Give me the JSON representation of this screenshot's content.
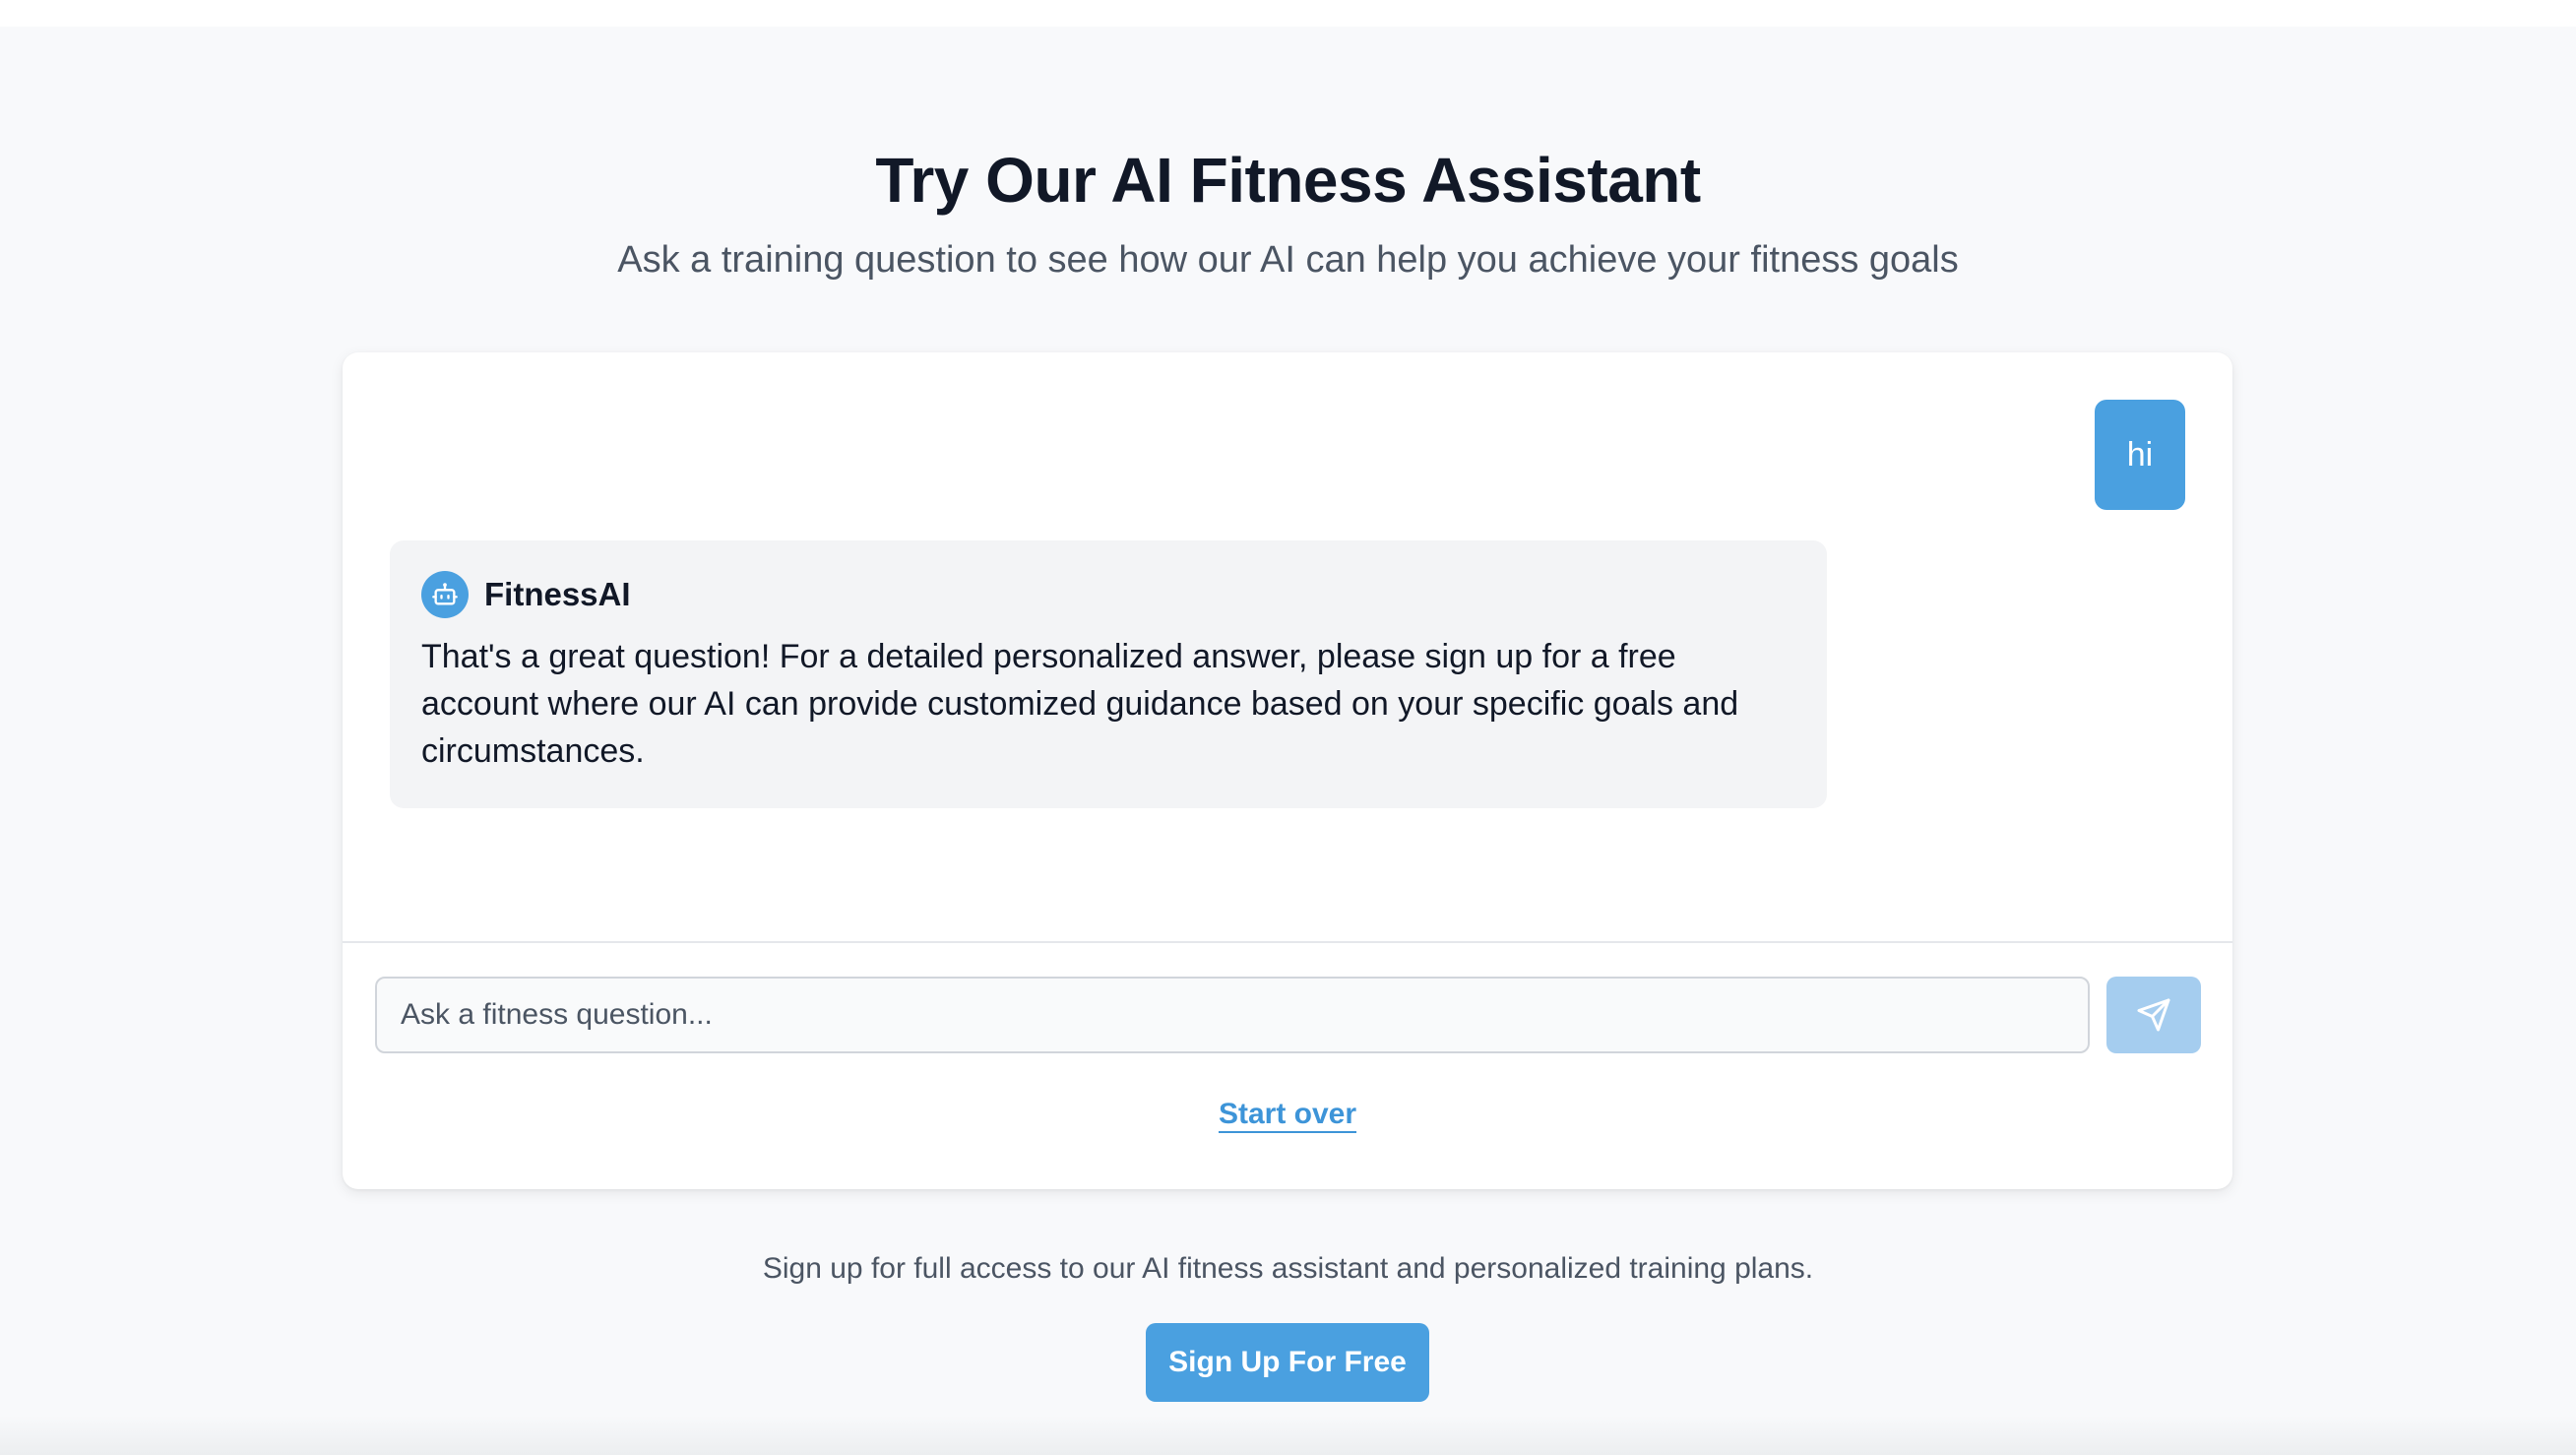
{
  "header": {
    "title": "Try Our AI Fitness Assistant",
    "subtitle": "Ask a training question to see how our AI can help you achieve your fitness goals"
  },
  "chat": {
    "messages": [
      {
        "role": "user",
        "text": "hi"
      },
      {
        "role": "assistant",
        "name": "FitnessAI",
        "avatar_icon": "robot-icon",
        "text": "That's a great question! For a detailed personalized answer, please sign up for a free account where our AI can provide customized guidance based on your specific goals and circumstances."
      }
    ],
    "input": {
      "placeholder": "Ask a fitness question...",
      "value": ""
    },
    "send_icon": "paper-plane-icon",
    "start_over_label": "Start over"
  },
  "cta": {
    "note": "Sign up for full access to our AI fitness assistant and personalized training plans.",
    "button_label": "Sign Up For Free"
  },
  "colors": {
    "accent": "#4aa0e0",
    "send_disabled": "#a5cdef",
    "page_bg": "#f8f9fb",
    "ai_bubble_bg": "#f3f4f6"
  }
}
